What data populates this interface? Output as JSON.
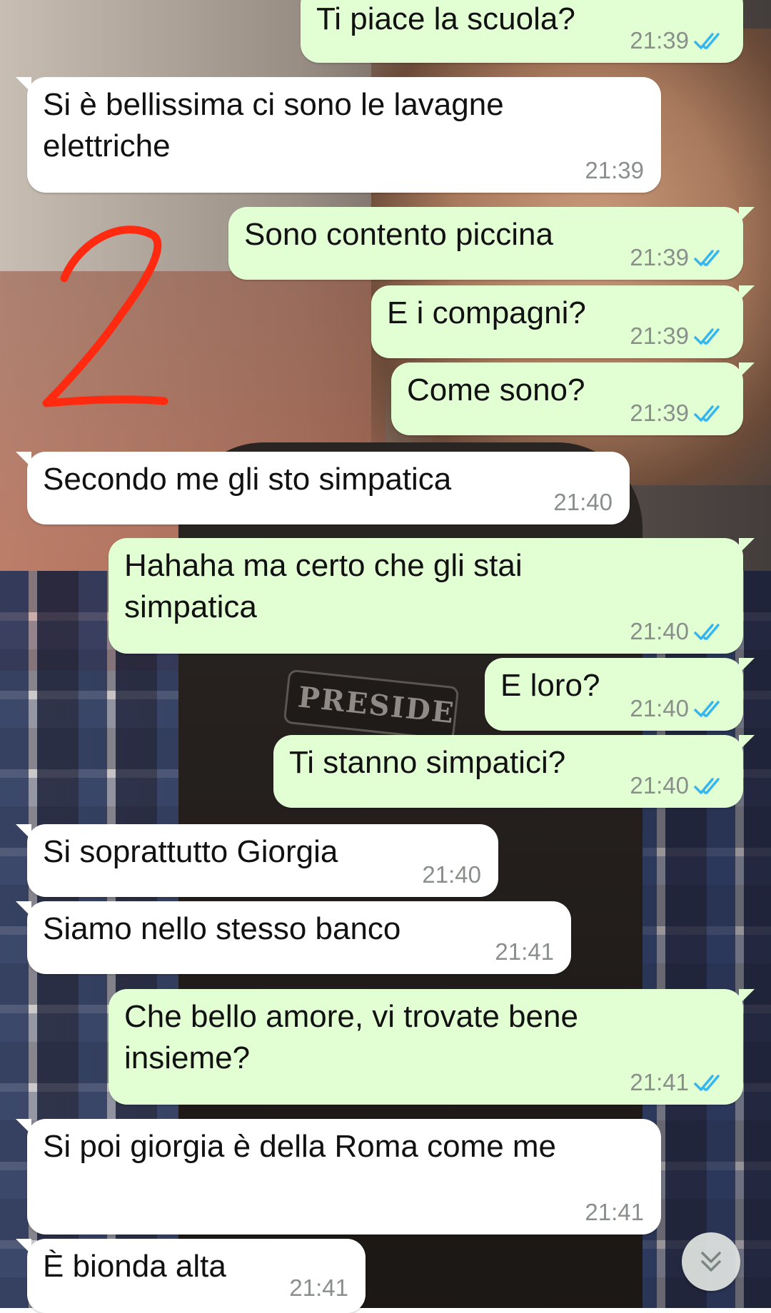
{
  "overlay_mark": "2",
  "messages": [
    {
      "dir": "out",
      "text": [
        "Ti piace la scuola?"
      ],
      "time": "21:39",
      "read": true
    },
    {
      "dir": "in",
      "text": [
        "Si è bellissima ci sono le lavagne",
        "elettriche"
      ],
      "time": "21:39"
    },
    {
      "dir": "out",
      "text": [
        "Sono contento piccina"
      ],
      "time": "21:39",
      "read": true
    },
    {
      "dir": "out",
      "text": [
        "E i compagni?"
      ],
      "time": "21:39",
      "read": true
    },
    {
      "dir": "out",
      "text": [
        "Come sono?"
      ],
      "time": "21:39",
      "read": true
    },
    {
      "dir": "in",
      "text": [
        "Secondo me gli sto simpatica"
      ],
      "time": "21:40"
    },
    {
      "dir": "out",
      "text": [
        "Hahaha ma certo che gli stai",
        "simpatica"
      ],
      "time": "21:40",
      "read": true
    },
    {
      "dir": "out",
      "text": [
        "E loro?"
      ],
      "time": "21:40",
      "read": true
    },
    {
      "dir": "out",
      "text": [
        "Ti stanno simpatici?"
      ],
      "time": "21:40",
      "read": true
    },
    {
      "dir": "in",
      "text": [
        "Si soprattutto Giorgia"
      ],
      "time": "21:40"
    },
    {
      "dir": "in",
      "text": [
        "Siamo nello stesso banco"
      ],
      "time": "21:41"
    },
    {
      "dir": "out",
      "text": [
        "Che bello amore, vi trovate bene",
        "insieme?"
      ],
      "time": "21:41",
      "read": true
    },
    {
      "dir": "in",
      "text": [
        "Si poi giorgia è della Roma come me"
      ],
      "time": "21:41"
    },
    {
      "dir": "in",
      "text": [
        "È bionda alta"
      ],
      "time": "21:41"
    }
  ],
  "wallpaper_patch_text": "PRESIDE",
  "icons": {
    "read_receipt": "double-check-icon",
    "scroll": "double-chevron-down-icon"
  },
  "colors": {
    "incoming_bubble": "#ffffff",
    "outgoing_bubble": "#e2ffd4",
    "read_tick": "#34b7f1",
    "scribble": "#ff2a10"
  }
}
